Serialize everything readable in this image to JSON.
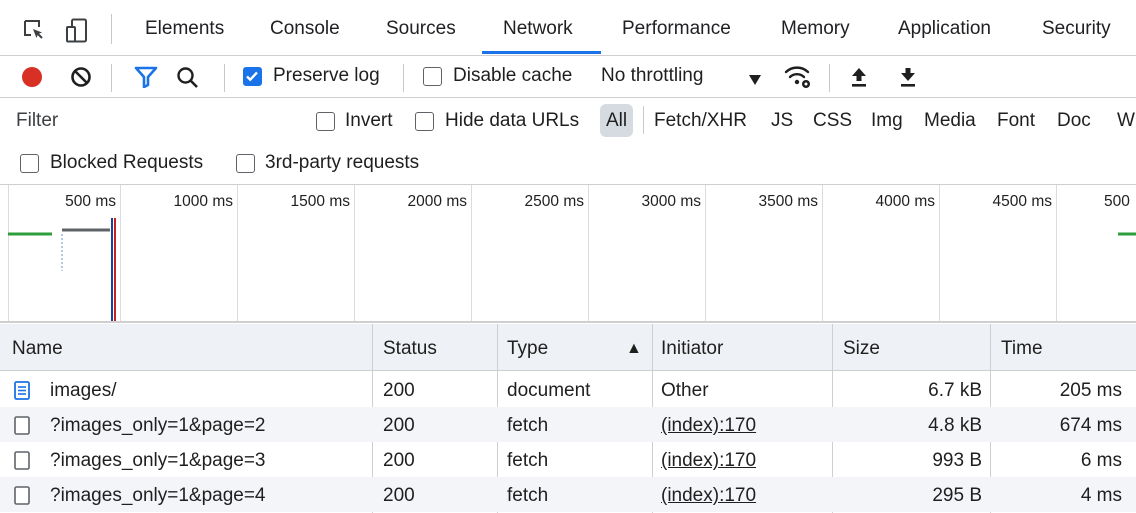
{
  "tabs": [
    {
      "label": "Elements"
    },
    {
      "label": "Console"
    },
    {
      "label": "Sources"
    },
    {
      "label": "Network"
    },
    {
      "label": "Performance"
    },
    {
      "label": "Memory"
    },
    {
      "label": "Application"
    },
    {
      "label": "Security"
    }
  ],
  "active_tab": "Network",
  "toolbar": {
    "preserve_log_label": "Preserve log",
    "preserve_log_checked": true,
    "disable_cache_label": "Disable cache",
    "disable_cache_checked": false,
    "throttling_value": "No throttling",
    "record_color": "#d93025",
    "filter_icon_color": "#1a73e8"
  },
  "filter": {
    "placeholder": "Filter",
    "invert_label": "Invert",
    "hide_data_urls_label": "Hide data URLs",
    "types": [
      "All",
      "Fetch/XHR",
      "JS",
      "CSS",
      "Img",
      "Media",
      "Font",
      "Doc",
      "W"
    ],
    "selected_type": "All",
    "blocked_requests_label": "Blocked Requests",
    "third_party_label": "3rd-party requests"
  },
  "timeline": {
    "ticks": [
      "500 ms",
      "1000 ms",
      "1500 ms",
      "2000 ms",
      "2500 ms",
      "3000 ms",
      "3500 ms",
      "4000 ms",
      "4500 ms",
      "500"
    ]
  },
  "table": {
    "columns": {
      "name": "Name",
      "status": "Status",
      "type": "Type",
      "initiator": "Initiator",
      "size": "Size",
      "time": "Time"
    },
    "sort_indicator": "▲",
    "rows": [
      {
        "name": "images/",
        "status": "200",
        "type": "document",
        "initiator": "Other",
        "size": "6.7 kB",
        "time": "205 ms",
        "icon": "document-icon"
      },
      {
        "name": "?images_only=1&page=2",
        "status": "200",
        "type": "fetch",
        "initiator": "(index):170",
        "size": "4.8 kB",
        "time": "674 ms",
        "icon": "fetch-icon"
      },
      {
        "name": "?images_only=1&page=3",
        "status": "200",
        "type": "fetch",
        "initiator": "(index):170",
        "size": "993 B",
        "time": "6 ms",
        "icon": "fetch-icon"
      },
      {
        "name": "?images_only=1&page=4",
        "status": "200",
        "type": "fetch",
        "initiator": "(index):170",
        "size": "295 B",
        "time": "4 ms",
        "icon": "fetch-icon"
      }
    ]
  }
}
